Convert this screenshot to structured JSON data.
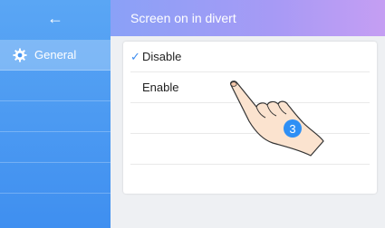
{
  "header": {
    "title": "Screen on in divert"
  },
  "sidebar": {
    "back_label": "←",
    "items": [
      {
        "label": "General",
        "icon": "gear-icon",
        "active": true
      }
    ]
  },
  "options": [
    {
      "label": "Disable",
      "selected": true,
      "mark": "✓"
    },
    {
      "label": "Enable",
      "selected": false
    }
  ],
  "hand_step": "3",
  "colors": {
    "sidebar": "#4a98f2",
    "header_start": "#8aa1f7",
    "header_end": "#c59ef3",
    "check": "#3d8df0",
    "step_badge": "#2e8ff5"
  }
}
